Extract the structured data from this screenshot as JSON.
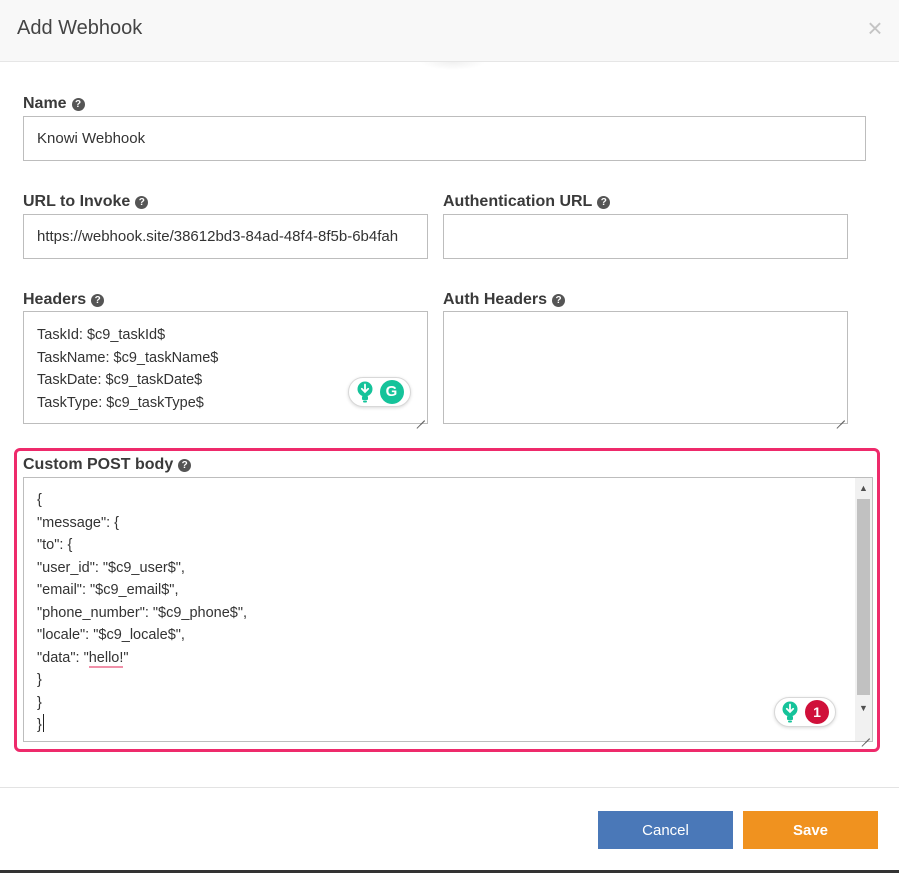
{
  "dialog": {
    "title": "Add Webhook",
    "close_glyph": "×"
  },
  "fields": {
    "name": {
      "label": "Name",
      "value": "Knowi Webhook"
    },
    "url_to_invoke": {
      "label": "URL to Invoke",
      "value": "https://webhook.site/38612bd3-84ad-48f4-8f5b-6b4fah"
    },
    "authentication_url": {
      "label": "Authentication URL",
      "value": ""
    },
    "headers": {
      "label": "Headers",
      "lines": [
        "TaskId: $c9_taskId$",
        "TaskName: $c9_taskName$",
        "TaskDate: $c9_taskDate$",
        "TaskType: $c9_taskType$"
      ]
    },
    "auth_headers": {
      "label": "Auth Headers",
      "value": ""
    },
    "custom_post_body": {
      "label": "Custom POST body",
      "lines": [
        "{",
        "\"message\": {",
        "\"to\": {",
        "\"user_id\": \"$c9_user$\",",
        "\"email\": \"$c9_email$\",",
        "\"phone_number\": \"$c9_phone$\",",
        "\"locale\": \"$c9_locale$\",",
        "\"data\": \"",
        "}",
        "}",
        "}"
      ],
      "misspelled_word": "hello!",
      "line_8_suffix": "\""
    }
  },
  "help_glyph": "?",
  "grammarly": {
    "g_letter": "G",
    "issue_count": "1"
  },
  "buttons": {
    "cancel": "Cancel",
    "save": "Save"
  },
  "colors": {
    "cancel_bg": "#4a78b8",
    "save_bg": "#f0921f",
    "highlight": "#ee2a6b",
    "grammarly_green": "#15c39a",
    "grammarly_red": "#d0103a"
  },
  "icons": [
    "help-icon",
    "close-icon",
    "grammarly-bulb-icon",
    "grammarly-g-icon",
    "grammarly-issue-badge-icon",
    "resize-grip-icon",
    "scroll-up-icon",
    "scroll-down-icon"
  ]
}
